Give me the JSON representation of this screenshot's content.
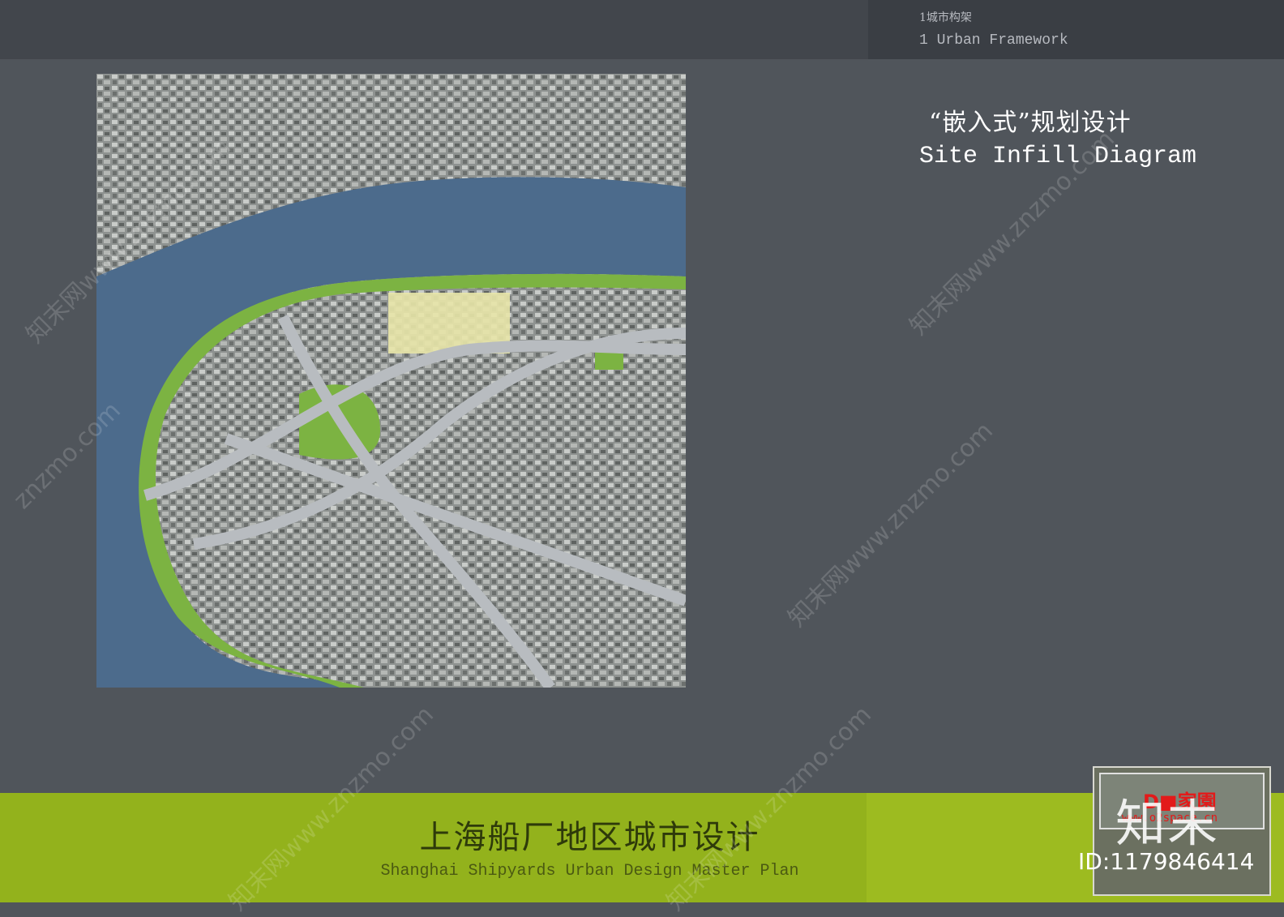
{
  "header": {
    "section_cn": "1城市构架",
    "section_en": "1 Urban Framework"
  },
  "main": {
    "heading_cn": "“嵌入式”规划设计",
    "heading_en": "Site Infill Diagram"
  },
  "footer": {
    "title_cn": "上海船厂地区城市设计",
    "title_en": "Shanghai Shipyards Urban Design Master Plan"
  },
  "watermark": {
    "site_text": "znzmo.com",
    "brand_text": "知末网www.znzmo.com",
    "brand_mark": "知末",
    "id_label": "ID:1179846414"
  },
  "logo": {
    "text": "D■家園",
    "url": "www.o2space.cn"
  },
  "colors": {
    "background": "#50555b",
    "top_bar": "#42464c",
    "footer_green": "#93b21c",
    "river": "#4c6b8c",
    "park_green": "#7cb342",
    "road_grey": "#b8bcc0"
  }
}
